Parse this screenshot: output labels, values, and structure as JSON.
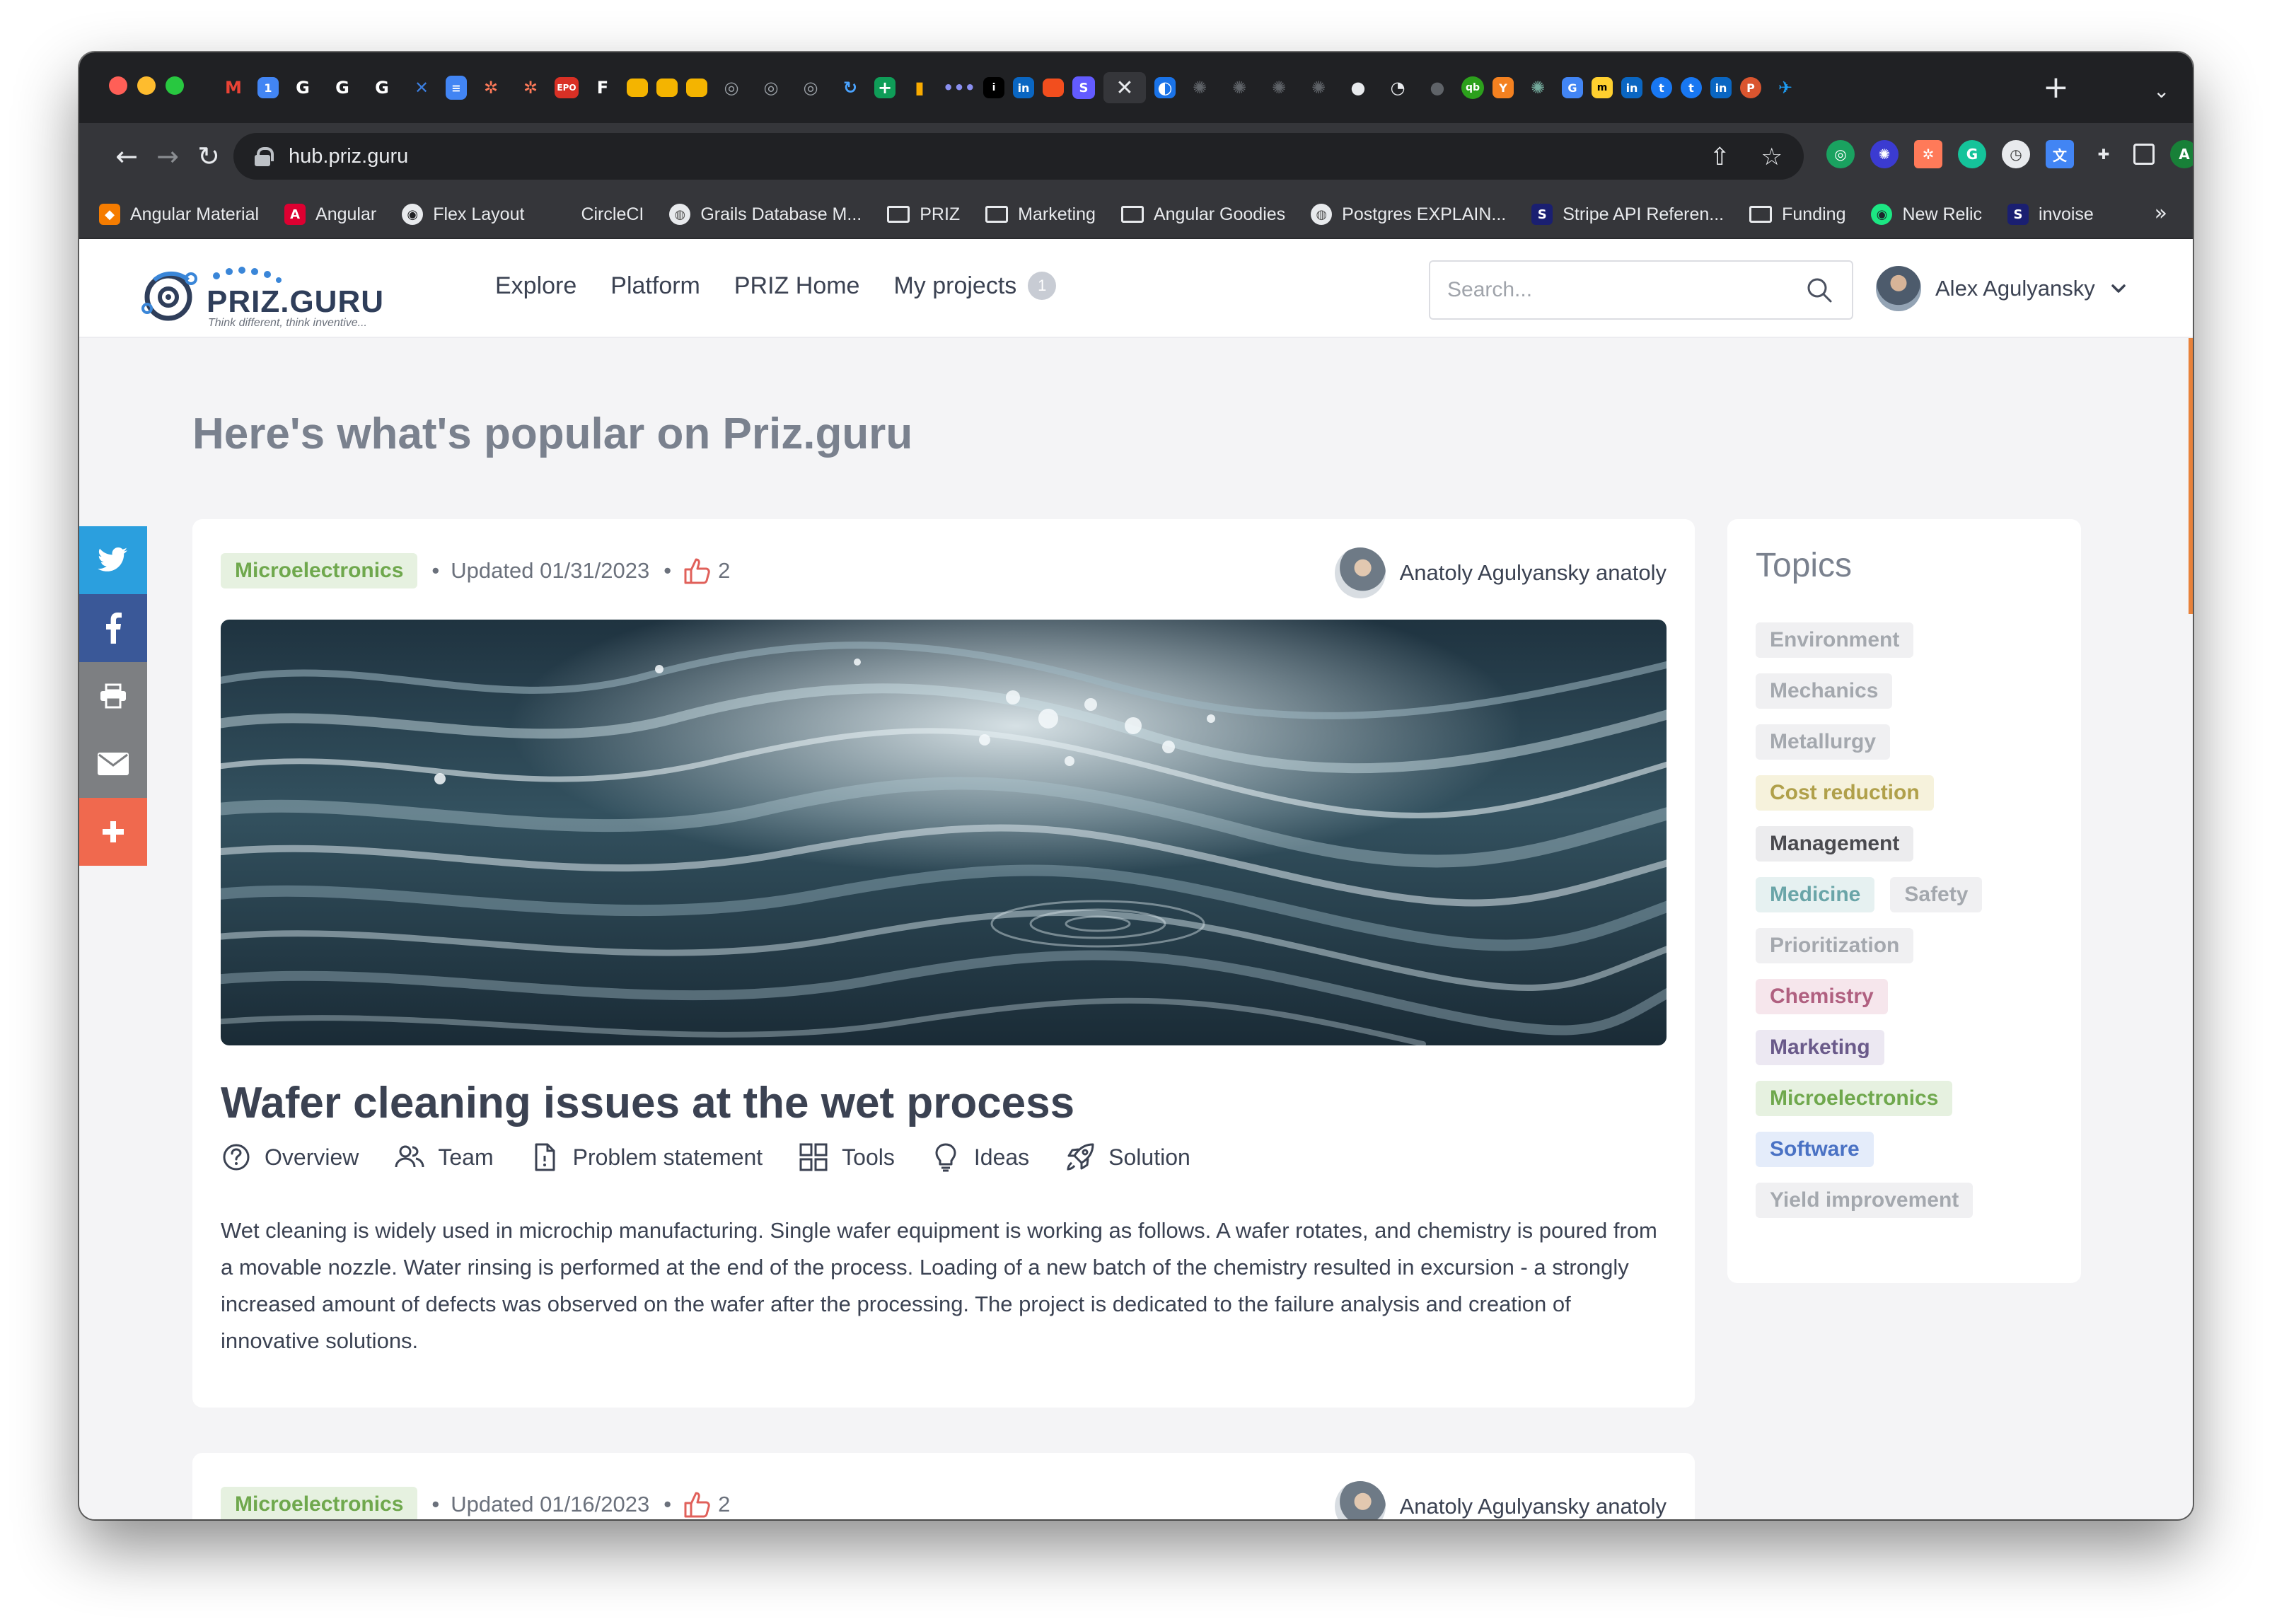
{
  "browser": {
    "url": "hub.priz.guru",
    "bookmarks": [
      {
        "label": "Angular Material",
        "icon": "angular-material-icon",
        "color": "#f57c00"
      },
      {
        "label": "Angular",
        "icon": "angular-icon",
        "color": "#dd0031"
      },
      {
        "label": "Flex Layout",
        "icon": "github-icon",
        "color": "#333333"
      },
      {
        "label": "CircleCI",
        "icon": "circleci-icon",
        "color": "#343434"
      },
      {
        "label": "Grails Database M...",
        "icon": "globe-icon",
        "color": "#777777"
      },
      {
        "label": "PRIZ",
        "icon": "folder-icon",
        "color": ""
      },
      {
        "label": "Marketing",
        "icon": "folder-icon",
        "color": ""
      },
      {
        "label": "Angular Goodies",
        "icon": "folder-icon",
        "color": ""
      },
      {
        "label": "Postgres EXPLAIN...",
        "icon": "globe-icon",
        "color": "#777777"
      },
      {
        "label": "Stripe API Referen...",
        "icon": "stripe-icon",
        "color": "#1a1f71"
      },
      {
        "label": "Funding",
        "icon": "folder-icon",
        "color": ""
      },
      {
        "label": "New Relic",
        "icon": "new-relic-icon",
        "color": "#1ce783"
      },
      {
        "label": "invoise",
        "icon": "stripe-icon",
        "color": "#1a1f71"
      }
    ]
  },
  "site": {
    "logo_text": "PRIZ.GURU",
    "logo_tagline": "Think different, think inventive...",
    "nav": {
      "explore": "Explore",
      "platform": "Platform",
      "priz_home": "PRIZ Home",
      "my_projects": "My projects",
      "my_projects_count": "1"
    },
    "search_placeholder": "Search...",
    "user_name": "Alex Agulyansky",
    "page_heading": "Here's what's popular on Priz.guru",
    "colors": {
      "accent": "#e8823b",
      "twitter": "#2b9fde",
      "facebook": "#3a5898",
      "print": "#7d7f82",
      "email": "#7d7f82",
      "more": "#f0694e"
    }
  },
  "posts": [
    {
      "tag": "Microelectronics",
      "updated": "Updated 01/31/2023",
      "likes": "2",
      "author": "Anatoly Agulyansky anatoly",
      "title": "Wafer cleaning issues at the wet process",
      "tabs": {
        "overview": "Overview",
        "team": "Team",
        "problem_statement": "Problem statement",
        "tools": "Tools",
        "ideas": "Ideas",
        "solution": "Solution"
      },
      "description": "Wet cleaning is widely used in microchip manufacturing. Single wafer equipment is working as follows. A wafer rotates, and chemistry is poured from a movable nozzle. Water rinsing is performed at the end of the process. Loading of a new batch of the chemistry resulted in excursion - a strongly increased amount of defects was observed on the wafer after the processing. The project is dedicated to the failure analysis and creation of innovative solutions."
    },
    {
      "tag": "Microelectronics",
      "updated": "Updated 01/16/2023",
      "likes": "2",
      "author": "Anatoly Agulyansky anatoly"
    }
  ],
  "topics": {
    "title": "Topics",
    "items": [
      {
        "label": "Environment",
        "bg": "#f0f0f2",
        "fg": "#a4a8ae"
      },
      {
        "label": "Mechanics",
        "bg": "#f0f0f2",
        "fg": "#a4a8ae"
      },
      {
        "label": "Metallurgy",
        "bg": "#f0f0f2",
        "fg": "#a4a8ae"
      },
      {
        "label": "Cost reduction",
        "bg": "#f6f2dc",
        "fg": "#b0a04a"
      },
      {
        "label": "Management",
        "bg": "#ececee",
        "fg": "#4a4a4f"
      },
      {
        "label": "Medicine",
        "bg": "#e6f1f1",
        "fg": "#6aa5a8"
      },
      {
        "label": "Safety",
        "bg": "#f0f0f2",
        "fg": "#a4a8ae"
      },
      {
        "label": "Prioritization",
        "bg": "#f0f0f2",
        "fg": "#a4a8ae"
      },
      {
        "label": "Chemistry",
        "bg": "#f6e6ec",
        "fg": "#b06080"
      },
      {
        "label": "Marketing",
        "bg": "#ece8f2",
        "fg": "#6a5a8a"
      },
      {
        "label": "Microelectronics",
        "bg": "#e6f1e0",
        "fg": "#6fa84d"
      },
      {
        "label": "Software",
        "bg": "#e4ecfa",
        "fg": "#4a72c4"
      },
      {
        "label": "Yield improvement",
        "bg": "#f0f0f2",
        "fg": "#a4a8ae"
      }
    ]
  }
}
